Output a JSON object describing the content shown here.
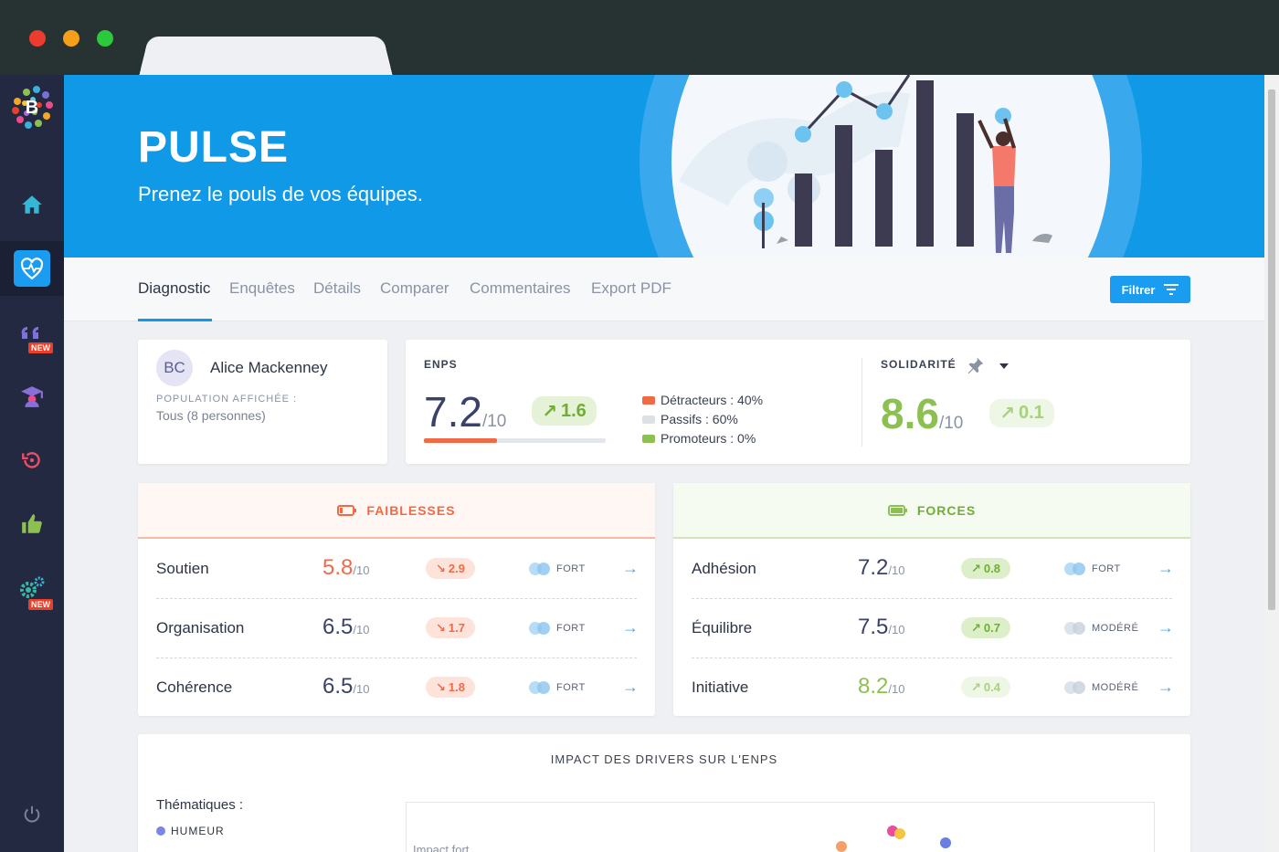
{
  "banner": {
    "title": "PULSE",
    "subtitle": "Prenez le pouls de vos équipes."
  },
  "sidebar": {
    "items": [
      {
        "icon": "home-icon"
      },
      {
        "icon": "heart-pulse-icon",
        "active": true
      },
      {
        "icon": "quote-icon",
        "badge": "NEW"
      },
      {
        "icon": "graduate-icon"
      },
      {
        "icon": "history-icon"
      },
      {
        "icon": "thumbs-up-icon"
      },
      {
        "icon": "gears-icon",
        "badge": "NEW"
      },
      {
        "icon": "power-icon"
      }
    ]
  },
  "tabs": [
    "Diagnostic",
    "Enquêtes",
    "Détails",
    "Comparer",
    "Commentaires",
    "Export PDF"
  ],
  "filter_label": "Filtrer",
  "user": {
    "initials": "BC",
    "name": "Alice Mackenney",
    "population_label": "POPULATION AFFICHÉE :",
    "population_value": "Tous (8 personnes)"
  },
  "enps": {
    "label": "ENPS",
    "score": "7.2",
    "scale": "/10",
    "delta": "1.6",
    "progress": 0.4,
    "legend": [
      {
        "label": "Détracteurs : 40%",
        "color": "#f26a45"
      },
      {
        "label": "Passifs : 60%",
        "color": "#dde0e4"
      },
      {
        "label": "Promoteurs : 0%",
        "color": "#8cc152"
      }
    ]
  },
  "solidarite": {
    "label": "SOLIDARITÉ",
    "score": "8.6",
    "scale": "/10",
    "delta": "0.1"
  },
  "weaknesses": {
    "title": "FAIBLESSES",
    "rows": [
      {
        "name": "Soutien",
        "score": "5.8",
        "scale": "/10",
        "delta": "2.9",
        "level": "FORT"
      },
      {
        "name": "Organisation",
        "score": "6.5",
        "scale": "/10",
        "delta": "1.7",
        "level": "FORT"
      },
      {
        "name": "Cohérence",
        "score": "6.5",
        "scale": "/10",
        "delta": "1.8",
        "level": "FORT"
      }
    ]
  },
  "strengths": {
    "title": "FORCES",
    "rows": [
      {
        "name": "Adhésion",
        "score": "7.2",
        "scale": "/10",
        "delta": "0.8",
        "level": "FORT"
      },
      {
        "name": "Équilibre",
        "score": "7.5",
        "scale": "/10",
        "delta": "0.7",
        "level": "MODÉRÉ"
      },
      {
        "name": "Initiative",
        "score": "8.2",
        "scale": "/10",
        "delta": "0.4",
        "level": "MODÉRÉ"
      }
    ]
  },
  "impact": {
    "title": "IMPACT DES DRIVERS SUR L'ENPS",
    "thematiques_label": "Thématiques :",
    "legend_first": "HUMEUR",
    "axis_label": "Impact fort"
  },
  "colors": {
    "accent": "#1296e8",
    "weak": "#f26a45",
    "strong": "#8cc152",
    "sidebar": "#232940"
  }
}
